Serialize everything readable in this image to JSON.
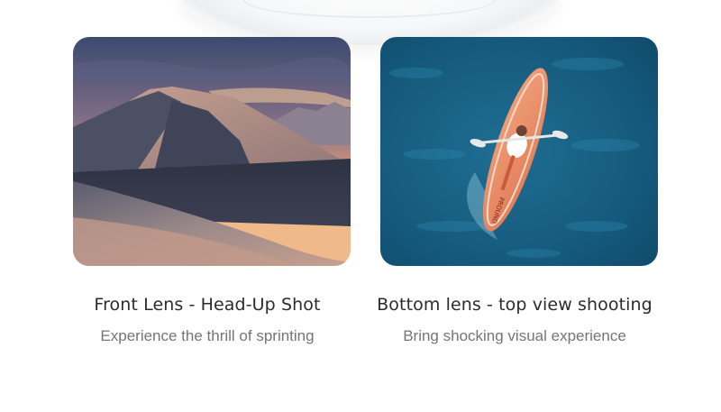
{
  "features": [
    {
      "title": "Front Lens - Head-Up Shot",
      "subtitle": "Experience the thrill of sprinting",
      "image": "desert-dunes-photo"
    },
    {
      "title": "Bottom lens - top view shooting",
      "subtitle": "Bring shocking visual experience",
      "image": "kayak-aerial-photo"
    }
  ],
  "kayak_text": "PROUND"
}
